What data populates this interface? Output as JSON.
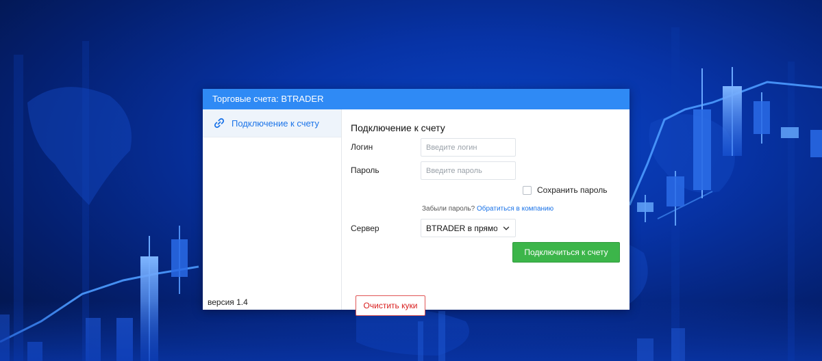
{
  "window": {
    "title": "Торговые счета: BTRADER"
  },
  "sidebar": {
    "items": [
      {
        "label": "Подключение к счету",
        "icon": "link-icon",
        "active": true
      }
    ],
    "version": "версия 1.4"
  },
  "main": {
    "title": "Подключение к счету",
    "login": {
      "label": "Логин",
      "value": "",
      "placeholder": "Введите логин"
    },
    "password": {
      "label": "Пароль",
      "value": "",
      "placeholder": "Введите пароль"
    },
    "save_password": {
      "label": "Сохранить пароль",
      "checked": false
    },
    "forgot": {
      "text": "Забыли пароль?",
      "link": "Обратиться в компанию"
    },
    "server": {
      "label": "Сервер",
      "value": "BTRADER в прямом",
      "icon": "chevron-down-icon"
    },
    "connect_button": "Подключиться к счету",
    "clear_cookies_button": "Очистить куки"
  },
  "colors": {
    "titlebar": "#2f8af5",
    "accent": "#1a73e8",
    "connect": "#3cb54a",
    "danger": "#d81b1b",
    "background": "#0733a6"
  }
}
